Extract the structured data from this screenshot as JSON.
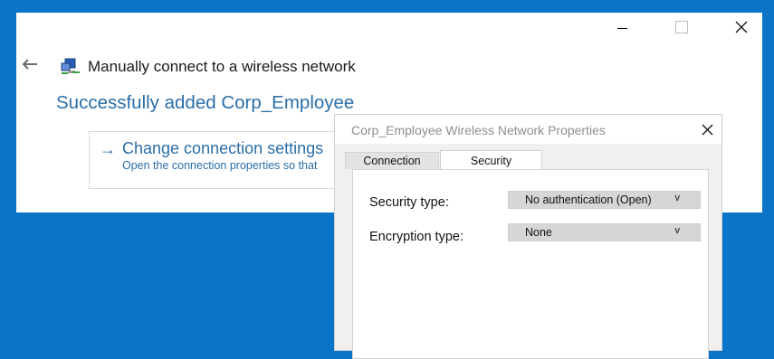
{
  "wizard": {
    "title": "Manually connect to a wireless network",
    "heading": "Successfully added Corp_Employee",
    "change_link": {
      "title": "Change connection settings",
      "description": "Open the connection properties so that"
    },
    "icons": {
      "back": "back-arrow-icon",
      "network": "network-icon",
      "minimize": "minimize-icon",
      "maximize": "maximize-icon",
      "close": "close-icon"
    }
  },
  "properties_dialog": {
    "title": "Corp_Employee Wireless Network Properties",
    "tabs": [
      {
        "label": "Connection",
        "active": false
      },
      {
        "label": "Security",
        "active": true
      }
    ],
    "fields": {
      "security_type": {
        "label": "Security type:",
        "value": "No authentication (Open)",
        "caret": "v"
      },
      "encryption_type": {
        "label": "Encryption type:",
        "value": "None",
        "caret": "v"
      }
    }
  },
  "colors": {
    "desktop": "#0a74c9",
    "link": "#2a6ea8",
    "combo_bg": "#d6d6d6"
  }
}
